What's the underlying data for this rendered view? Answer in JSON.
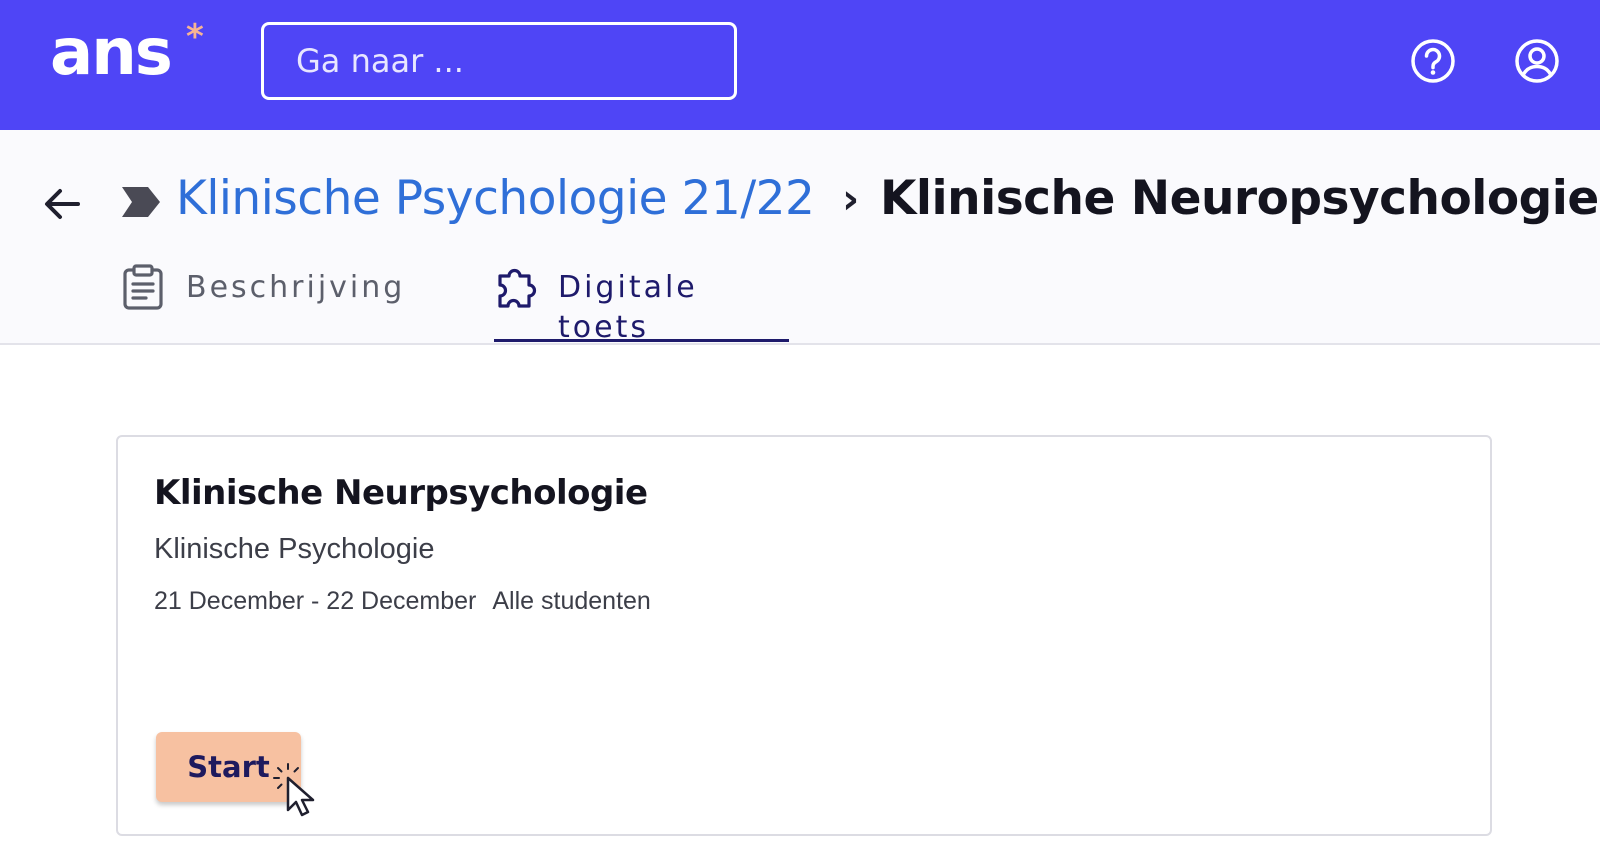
{
  "header": {
    "logo_text": "ans",
    "logo_star": "*",
    "search": {
      "placeholder": "Ga naar ...",
      "value": ""
    },
    "icons": [
      "help-icon",
      "account-icon"
    ]
  },
  "breadcrumb": {
    "parent": "Klinische Psychologie 21/22",
    "separator": "›",
    "current": "Klinische Neuropsychologie"
  },
  "tabs": [
    {
      "label": "Beschrijving",
      "icon": "clipboard-icon",
      "active": false
    },
    {
      "label": "Digitale toets",
      "icon": "puzzle-icon",
      "active": true
    }
  ],
  "card": {
    "title": "Klinische Neurpsychologie",
    "subtitle": "Klinische Psychologie",
    "date_range": "21 December - 22 December",
    "audience": "Alle studenten",
    "start_label": "Start"
  },
  "colors": {
    "header_bg": "#4f45f6",
    "logo_star": "#f7b493",
    "link": "#2f6fd8",
    "active_tab": "#1e1a6b",
    "start_button": "#f7c1a1"
  }
}
